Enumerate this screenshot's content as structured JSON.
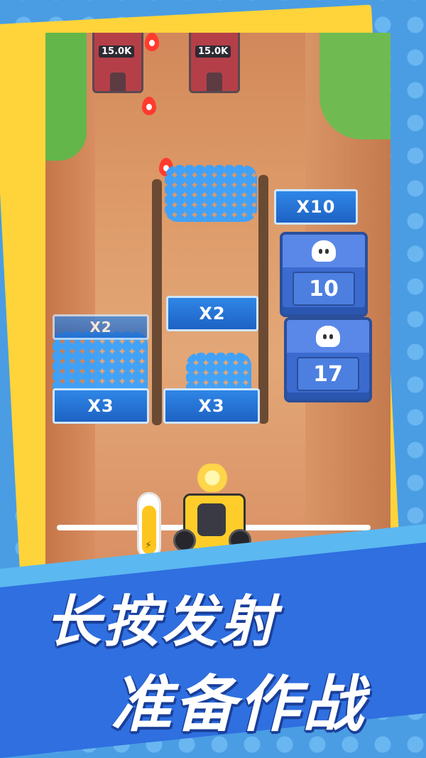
{
  "towers": [
    {
      "label": "15.0K"
    },
    {
      "label": "15.0K"
    }
  ],
  "gates": {
    "top_right": "X10",
    "middle": "X2",
    "left_partial": "X2",
    "bottom_left": "X3",
    "bottom_middle": "X3"
  },
  "crates": [
    {
      "value": "10",
      "icon": "ghost-icon"
    },
    {
      "value": "17",
      "icon": "ghost-icon"
    }
  ],
  "power": {
    "fraction": 0.85,
    "icon": "bolt-icon"
  },
  "slogan": {
    "line1": "长按发射",
    "line2": "准备作战"
  },
  "colors": {
    "background": "#4a9de3",
    "frame": "#ffd43a",
    "gate": "#1d62c4",
    "banner": "#2f6fe0"
  }
}
